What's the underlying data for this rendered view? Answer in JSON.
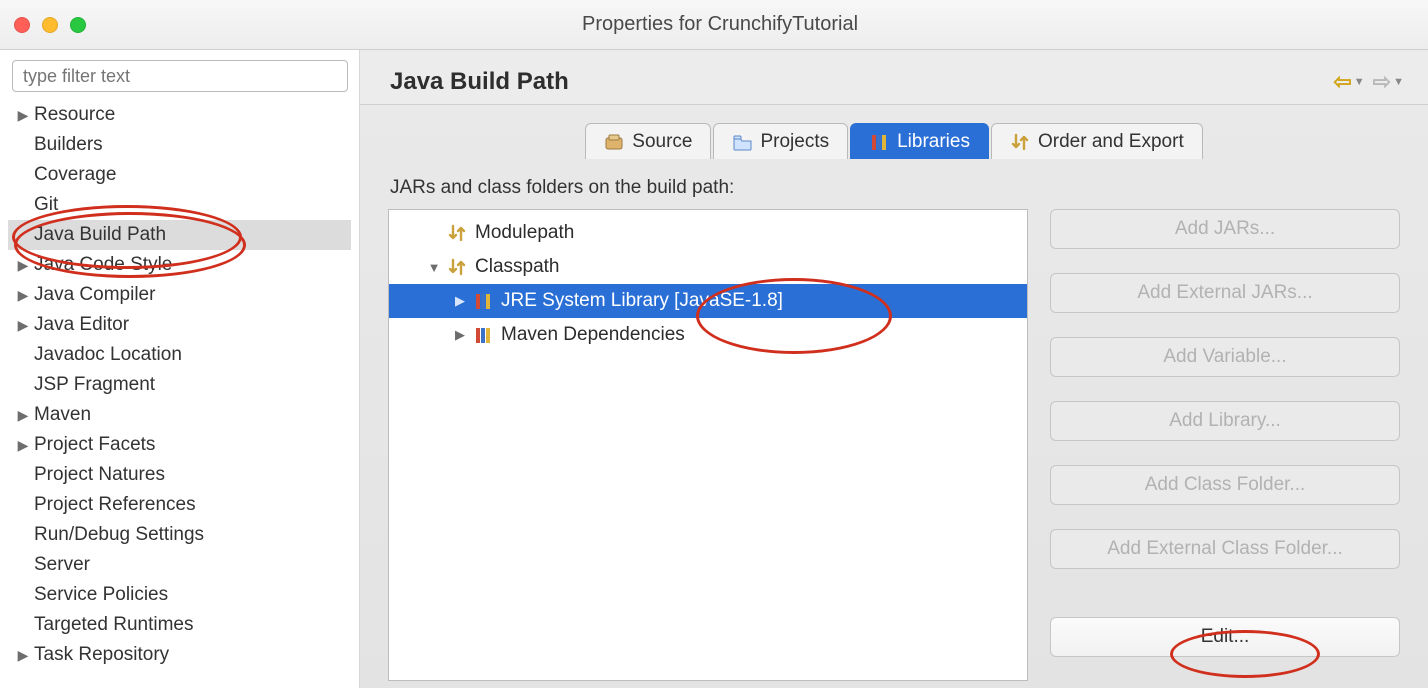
{
  "window": {
    "title": "Properties for CrunchifyTutorial"
  },
  "sidebar": {
    "filter_placeholder": "type filter text",
    "items": [
      {
        "label": "Resource",
        "expandable": true,
        "selected": false
      },
      {
        "label": "Builders",
        "expandable": false,
        "selected": false
      },
      {
        "label": "Coverage",
        "expandable": false,
        "selected": false
      },
      {
        "label": "Git",
        "expandable": false,
        "selected": false
      },
      {
        "label": "Java Build Path",
        "expandable": false,
        "selected": true
      },
      {
        "label": "Java Code Style",
        "expandable": true,
        "selected": false
      },
      {
        "label": "Java Compiler",
        "expandable": true,
        "selected": false
      },
      {
        "label": "Java Editor",
        "expandable": true,
        "selected": false
      },
      {
        "label": "Javadoc Location",
        "expandable": false,
        "selected": false
      },
      {
        "label": "JSP Fragment",
        "expandable": false,
        "selected": false
      },
      {
        "label": "Maven",
        "expandable": true,
        "selected": false
      },
      {
        "label": "Project Facets",
        "expandable": true,
        "selected": false
      },
      {
        "label": "Project Natures",
        "expandable": false,
        "selected": false
      },
      {
        "label": "Project References",
        "expandable": false,
        "selected": false
      },
      {
        "label": "Run/Debug Settings",
        "expandable": false,
        "selected": false
      },
      {
        "label": "Server",
        "expandable": false,
        "selected": false
      },
      {
        "label": "Service Policies",
        "expandable": false,
        "selected": false
      },
      {
        "label": "Targeted Runtimes",
        "expandable": false,
        "selected": false
      },
      {
        "label": "Task Repository",
        "expandable": true,
        "selected": false
      }
    ]
  },
  "main": {
    "title": "Java Build Path",
    "tabs": [
      {
        "label": "Source",
        "icon": "package",
        "active": false
      },
      {
        "label": "Projects",
        "icon": "folder",
        "active": false
      },
      {
        "label": "Libraries",
        "icon": "library",
        "active": true
      },
      {
        "label": "Order and Export",
        "icon": "order-export",
        "active": false
      }
    ],
    "caption": "JARs and class folders on the build path:",
    "tree": {
      "modulepath": {
        "label": "Modulepath",
        "icon": "order-export"
      },
      "classpath": {
        "label": "Classpath",
        "icon": "order-export",
        "expanded": true,
        "children": [
          {
            "label": "JRE System Library [JavaSE-1.8]",
            "icon": "library",
            "selected": true
          },
          {
            "label": "Maven Dependencies",
            "icon": "library",
            "selected": false
          }
        ]
      }
    },
    "buttons": {
      "add_jars": "Add JARs...",
      "add_external_jars": "Add External JARs...",
      "add_variable": "Add Variable...",
      "add_library": "Add Library...",
      "add_class_folder": "Add Class Folder...",
      "add_ext_class_folder": "Add External Class Folder...",
      "edit": "Edit..."
    }
  }
}
